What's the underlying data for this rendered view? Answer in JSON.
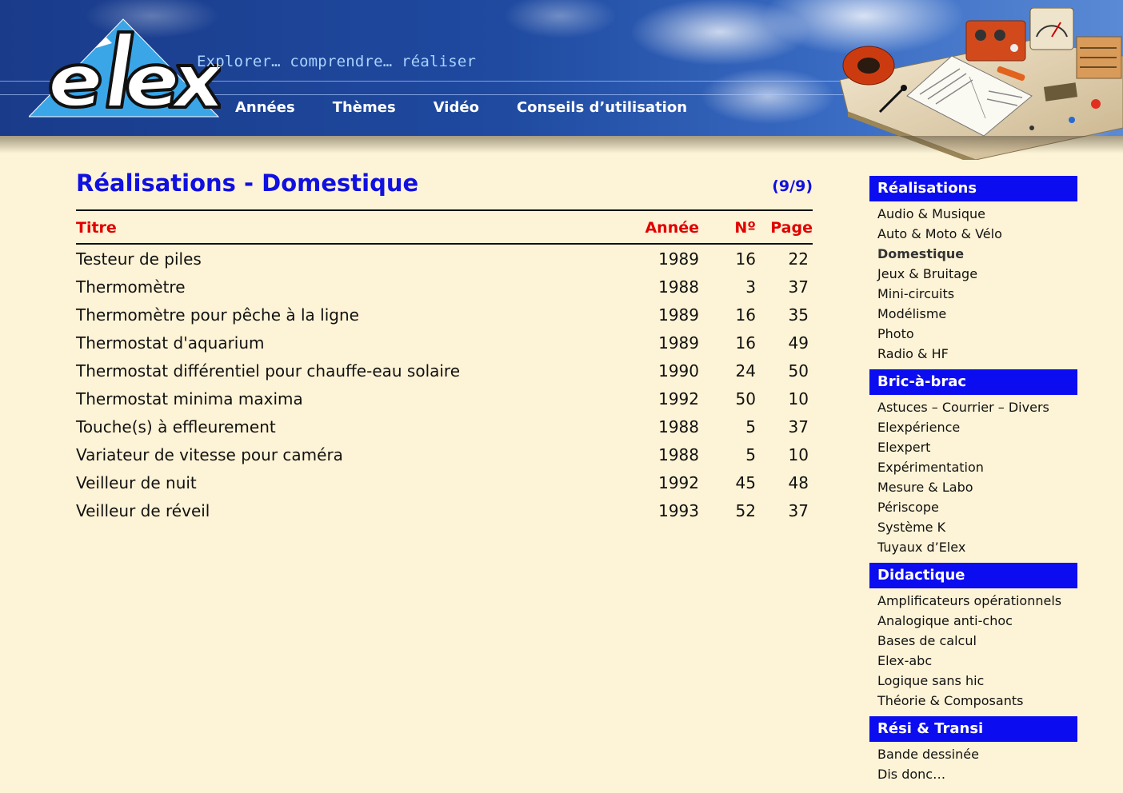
{
  "header": {
    "tagline": "Explorer… comprendre… réaliser",
    "nav": [
      "Années",
      "Thèmes",
      "Vidéo",
      "Conseils d’utilisation"
    ]
  },
  "main": {
    "title": "Réalisations - Domestique",
    "count": "(9/9)",
    "columns": {
      "title": "Titre",
      "year": "Année",
      "no": "Nº",
      "page": "Page"
    },
    "rows": [
      {
        "title": "Testeur de piles",
        "year": "1989",
        "no": "16",
        "page": "22"
      },
      {
        "title": "Thermomètre",
        "year": "1988",
        "no": "3",
        "page": "37"
      },
      {
        "title": "Thermomètre pour pêche à la ligne",
        "year": "1989",
        "no": "16",
        "page": "35"
      },
      {
        "title": "Thermostat d'aquarium",
        "year": "1989",
        "no": "16",
        "page": "49"
      },
      {
        "title": "Thermostat différentiel pour chauffe-eau solaire",
        "year": "1990",
        "no": "24",
        "page": "50"
      },
      {
        "title": "Thermostat minima maxima",
        "year": "1992",
        "no": "50",
        "page": "10"
      },
      {
        "title": "Touche(s) à effleurement",
        "year": "1988",
        "no": "5",
        "page": "37"
      },
      {
        "title": "Variateur de vitesse pour caméra",
        "year": "1988",
        "no": "5",
        "page": "10"
      },
      {
        "title": "Veilleur de nuit",
        "year": "1992",
        "no": "45",
        "page": "48"
      },
      {
        "title": "Veilleur de réveil",
        "year": "1993",
        "no": "52",
        "page": "37"
      }
    ]
  },
  "sidebar": {
    "sections": [
      {
        "heading": "Réalisations",
        "items": [
          "Audio & Musique",
          "Auto & Moto & Vélo",
          "Domestique",
          "Jeux & Bruitage",
          "Mini-circuits",
          "Modélisme",
          "Photo",
          "Radio & HF"
        ],
        "active": "Domestique"
      },
      {
        "heading": "Bric-à-brac",
        "items": [
          "Astuces – Courrier – Divers",
          "Elexpérience",
          "Elexpert",
          "Expérimentation",
          "Mesure & Labo",
          "Périscope",
          "Système K",
          "Tuyaux d’Elex"
        ]
      },
      {
        "heading": "Didactique",
        "items": [
          "Amplificateurs opérationnels",
          "Analogique anti-choc",
          "Bases de calcul",
          "Elex-abc",
          "Logique sans hic",
          "Théorie & Composants"
        ]
      },
      {
        "heading": "Rési & Transi",
        "items": [
          "Bande dessinée",
          "Dis donc…"
        ]
      }
    ]
  },
  "colors": {
    "page_background": "#fdf3d6",
    "title_blue": "#1010e0",
    "header_red": "#e00000",
    "sidebar_heading": "#0c0cf0",
    "logo_triangle": "#3aa6e8"
  },
  "icons": {
    "logo": "elex-logo",
    "header_photo": "electronics-workbench-photo"
  }
}
